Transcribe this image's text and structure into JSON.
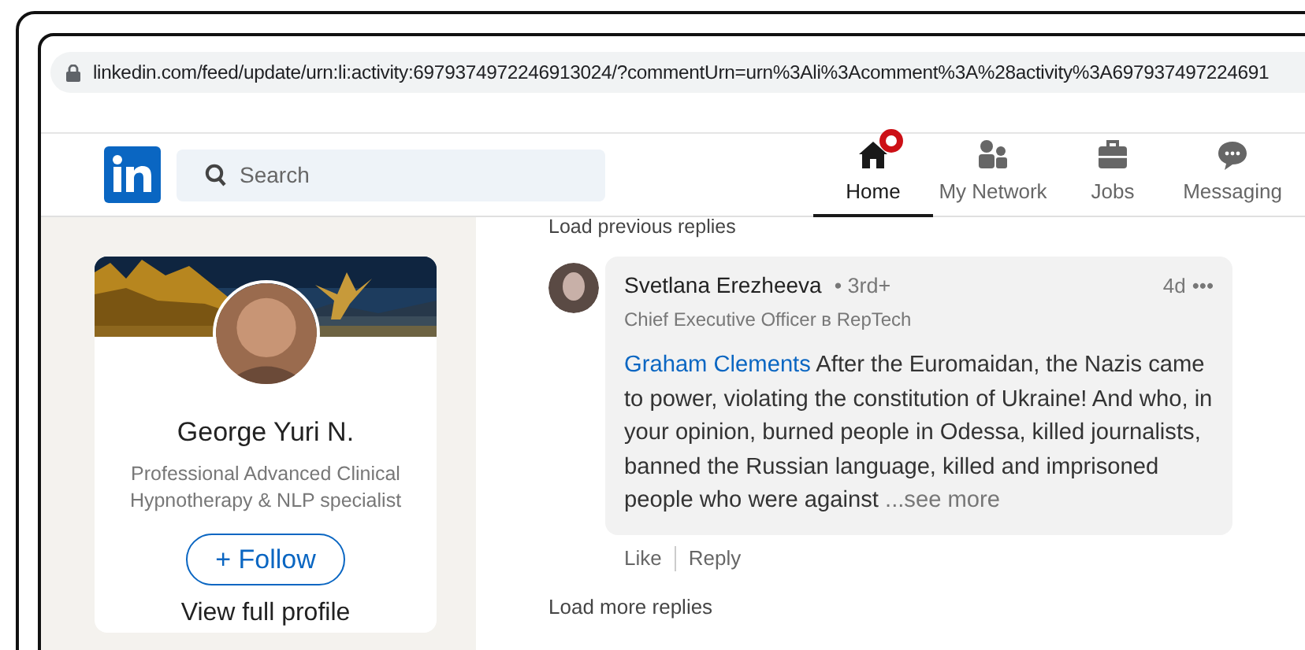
{
  "browser": {
    "url": "linkedin.com/feed/update/urn:li:activity:6979374972246913024/?commentUrn=urn%3Ali%3Acomment%3A%28activity%3A697937497224691"
  },
  "nav": {
    "search_placeholder": "Search",
    "items": [
      {
        "kind": "home",
        "label": "Home",
        "selected": true,
        "notification": true
      },
      {
        "kind": "network",
        "label": "My Network",
        "selected": false,
        "notification": false
      },
      {
        "kind": "jobs",
        "label": "Jobs",
        "selected": false,
        "notification": false
      },
      {
        "kind": "messaging",
        "label": "Messaging",
        "selected": false,
        "notification": false
      }
    ]
  },
  "profile_card": {
    "name": "George Yuri N.",
    "headline": "Professional Advanced Clinical Hypnotherapy & NLP specialist",
    "follow_button": "+ Follow",
    "link": "View full profile"
  },
  "thread": {
    "load_previous": "Load previous replies",
    "reply": {
      "author": "Svetlana Erezheeva",
      "degree": "• 3rd+",
      "author_title": "Chief Executive Officer в RepTech",
      "time": "4d",
      "menu": "•••",
      "mention": "Graham Clements",
      "text": "After the Euromaidan, the Nazis came to power, violating the constitution of Ukraine! And who, in your opinion, burned people in Odessa, killed journalists, banned the Russian language, killed and imprisoned people who were against",
      "see_more": "...see more",
      "actions": [
        "Like",
        "Reply"
      ]
    },
    "load_more": "Load more replies"
  }
}
